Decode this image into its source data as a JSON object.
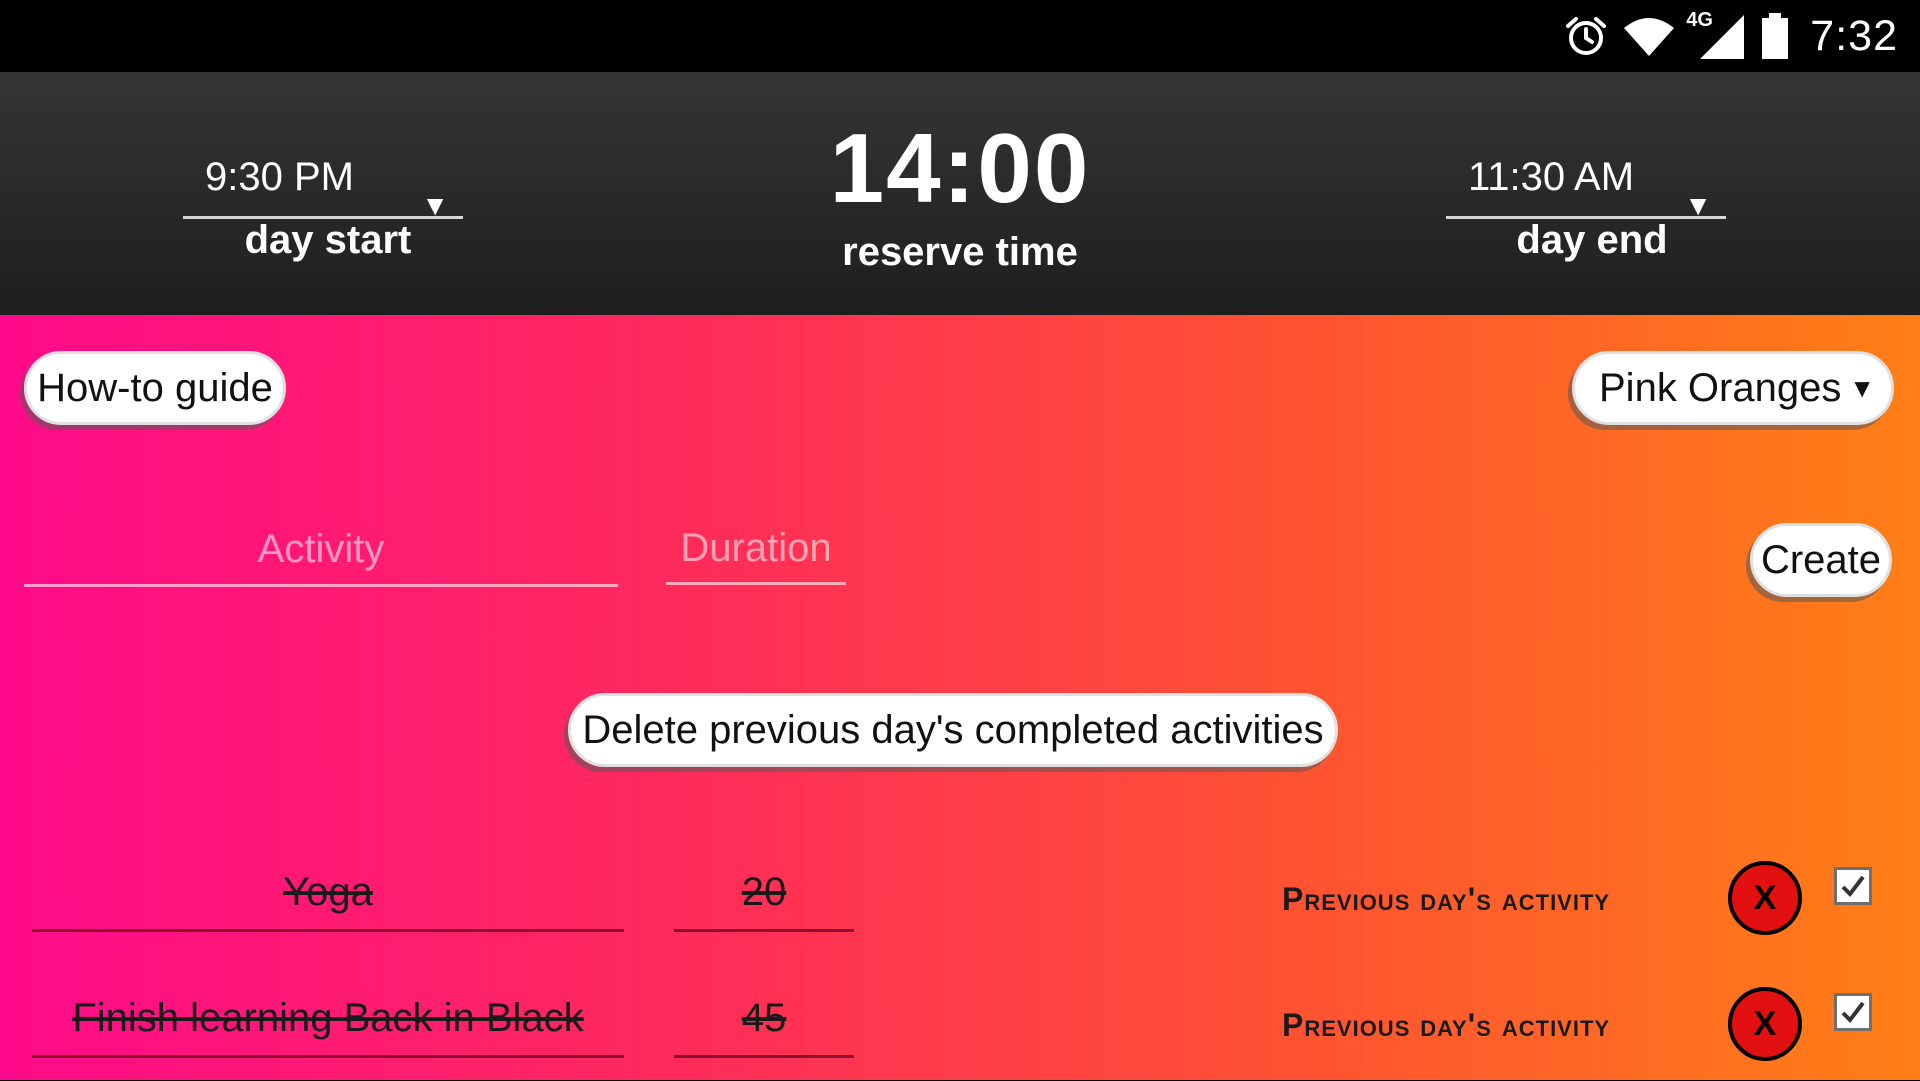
{
  "status_bar": {
    "time": "7:32",
    "network": "4G",
    "icons": [
      "alarm-icon",
      "wifi-icon",
      "signal-icon",
      "battery-icon"
    ]
  },
  "header": {
    "day_start": {
      "value": "9:30 PM",
      "label": "day start"
    },
    "reserve": {
      "value": "14:00",
      "label": "reserve time"
    },
    "day_end": {
      "value": "11:30 AM",
      "label": "day end"
    }
  },
  "controls": {
    "howto_label": "How-to guide",
    "theme_value": "Pink Oranges",
    "activity_placeholder": "Activity",
    "duration_placeholder": "Duration",
    "create_label": "Create",
    "delete_label": "Delete previous day's completed activities"
  },
  "activities": [
    {
      "name": "Yoga",
      "duration": "20",
      "status": "Previous day's activity",
      "remove": "X",
      "completed": true
    },
    {
      "name": "Finish learning Back in Black",
      "duration": "45",
      "status": "Previous day's activity",
      "remove": "X",
      "completed": true
    }
  ],
  "colors": {
    "gradient_start": "#ff0a8a",
    "gradient_end": "#ff7f16",
    "header_bg": "#2c2c2c",
    "remove_button": "#e21010"
  }
}
